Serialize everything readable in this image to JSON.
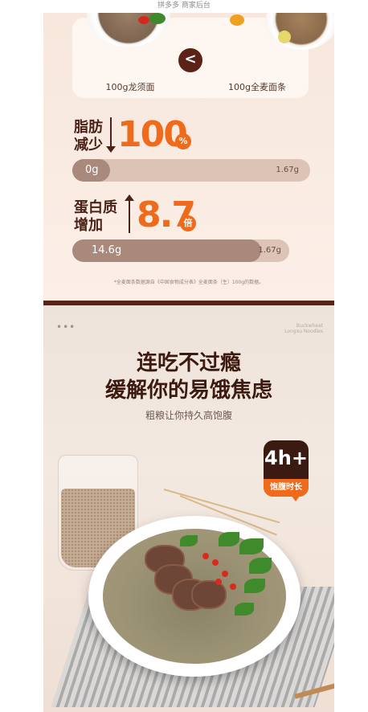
{
  "header": {
    "title": "拼多多 商家后台"
  },
  "comparison": {
    "left_label": "100g龙须面",
    "right_label": "100g全麦面条",
    "compare_symbol": "<"
  },
  "fat": {
    "label_line1": "脂肪",
    "label_line2": "减少",
    "value": "100",
    "unit": "%",
    "bar_left": "0g",
    "bar_right": "1.67g",
    "fill_fraction": 0.16
  },
  "protein": {
    "label_line1": "蛋白质",
    "label_line2": "增加",
    "value": "8.7",
    "unit": "倍",
    "bar_left": "14.6g",
    "bar_right": "1.67g",
    "fill_fraction": 0.87
  },
  "footnote": "*全麦面条数据源自《中国食物成分表》全麦面条（生）100g的数据。",
  "section2": {
    "dots": "•••",
    "brand_line1": "Buckwheat",
    "brand_line2": "Longxu Noodles",
    "headline1": "连吃不过瘾",
    "headline2": "缓解你的易饿焦虑",
    "subline": "粗粮让你持久高饱腹",
    "badge_value": "4h+",
    "badge_tag": "饱腹时长"
  },
  "colors": {
    "accent_orange": "#ef6a1a",
    "dark_brown": "#5b2317"
  }
}
